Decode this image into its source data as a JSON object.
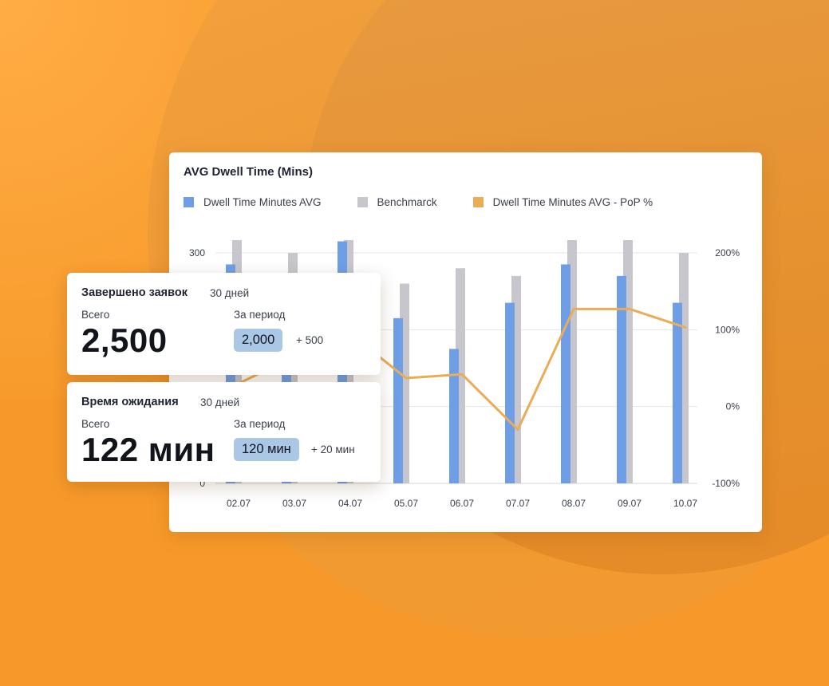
{
  "colors": {
    "primary_bar": "#6e9fe6",
    "benchmark_bar": "#c6c6cc",
    "line": "#e9ad57",
    "pill": "#aac8e6"
  },
  "chart_data": {
    "type": "bar",
    "title": "AVG Dwell Time (Mins)",
    "categories": [
      "02.07",
      "03.07",
      "04.07",
      "05.07",
      "06.07",
      "07.07",
      "08.07",
      "09.07",
      "10.07"
    ],
    "legend_position": "top-left",
    "grid": true,
    "left_axis": {
      "ticks": [
        "300",
        "0"
      ],
      "ylim": [
        0,
        300
      ]
    },
    "right_axis": {
      "ticks": [
        "200%",
        "100%",
        "0%",
        "-100%"
      ],
      "ylim": [
        -100,
        200
      ]
    },
    "series": [
      {
        "name": "Dwell Time Minutes AVG",
        "type": "bar",
        "axis": "left",
        "color": "#6e9fe6",
        "values": [
          285,
          235,
          315,
          215,
          175,
          235,
          285,
          270,
          235
        ]
      },
      {
        "name": "Benchmarck",
        "type": "bar",
        "axis": "left",
        "color": "#c6c6cc",
        "values": [
          320,
          300,
          320,
          260,
          280,
          270,
          320,
          320,
          300
        ]
      },
      {
        "name": "Dwell Time Minutes AVG - PoP %",
        "type": "line",
        "axis": "right",
        "color": "#e9ad57",
        "values": [
          30,
          65,
          95,
          37,
          42,
          -30,
          127,
          127,
          103
        ]
      }
    ]
  },
  "stat_cards": [
    {
      "title": "Завершено заявок",
      "period": "30 дней",
      "total_label": "Всего",
      "total_value": "2,500",
      "period_label": "За период",
      "period_value": "2,000",
      "delta": "+ 500"
    },
    {
      "title": "Время ожидания",
      "period": "30 дней",
      "total_label": "Всего",
      "total_value": "122 мин",
      "period_label": "За период",
      "period_value": "120 мин",
      "delta": "+ 20 мин"
    }
  ]
}
